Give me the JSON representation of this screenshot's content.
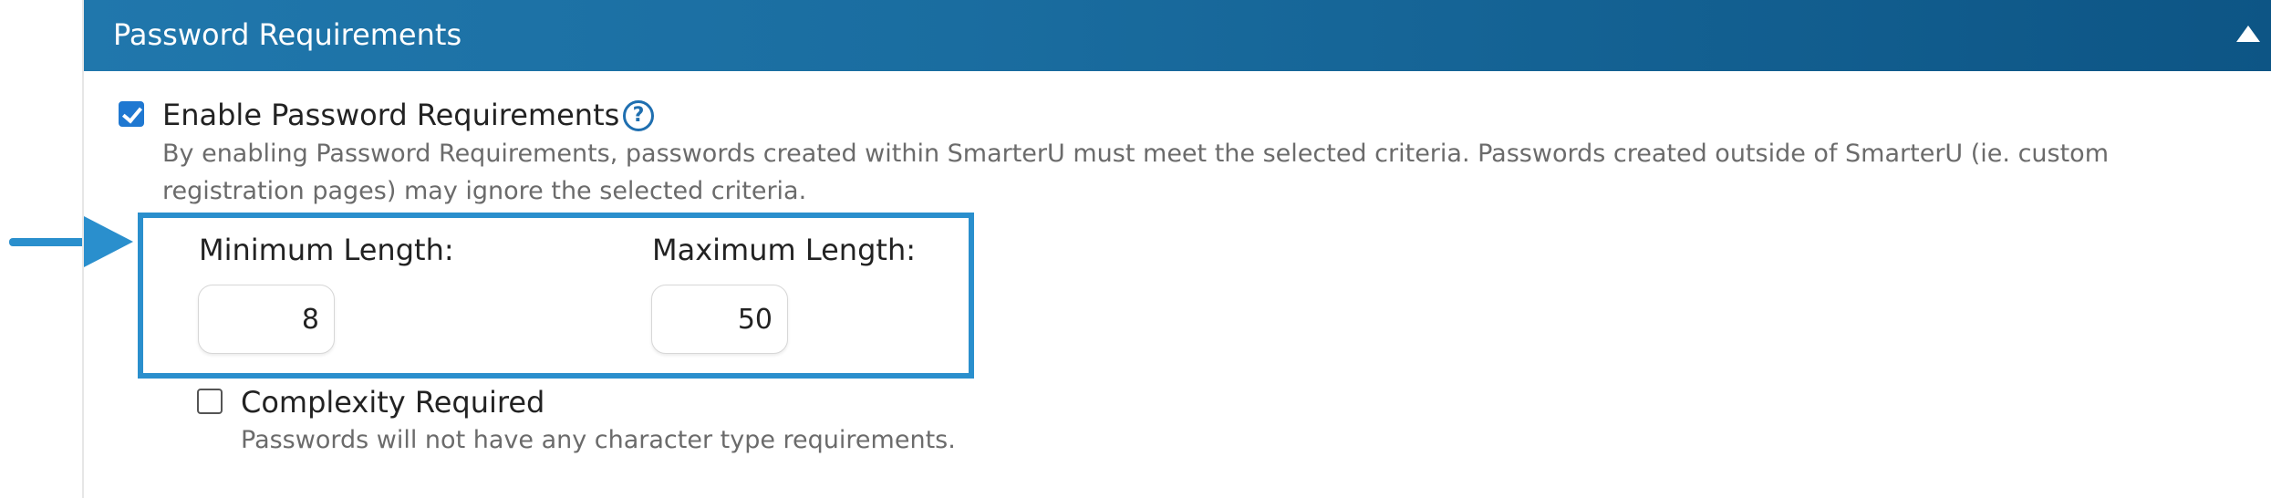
{
  "colors": {
    "header_start": "#2077ac",
    "header_end": "#0d5585",
    "highlight_border": "#2a8fcd",
    "checkbox_checked": "#1f78d1",
    "help_icon": "#1f6fb0",
    "arrow": "#2a8fcd"
  },
  "panel": {
    "title": "Password Requirements",
    "collapse_icon": "caret-up-icon"
  },
  "enable": {
    "checked": true,
    "label": "Enable Password Requirements",
    "help_icon": "question-circle-icon",
    "help_glyph": "?",
    "description": "By enabling Password Requirements, passwords created within SmarterU must meet the selected criteria. Passwords created outside of SmarterU (ie. custom registration pages) may ignore the selected criteria."
  },
  "length": {
    "min_label": "Minimum Length:",
    "min_value": "8",
    "max_label": "Maximum Length:",
    "max_value": "50"
  },
  "complexity": {
    "checked": false,
    "label": "Complexity Required",
    "description": "Passwords will not have any character type requirements."
  },
  "annotation": {
    "arrow_icon": "right-arrow-icon"
  }
}
